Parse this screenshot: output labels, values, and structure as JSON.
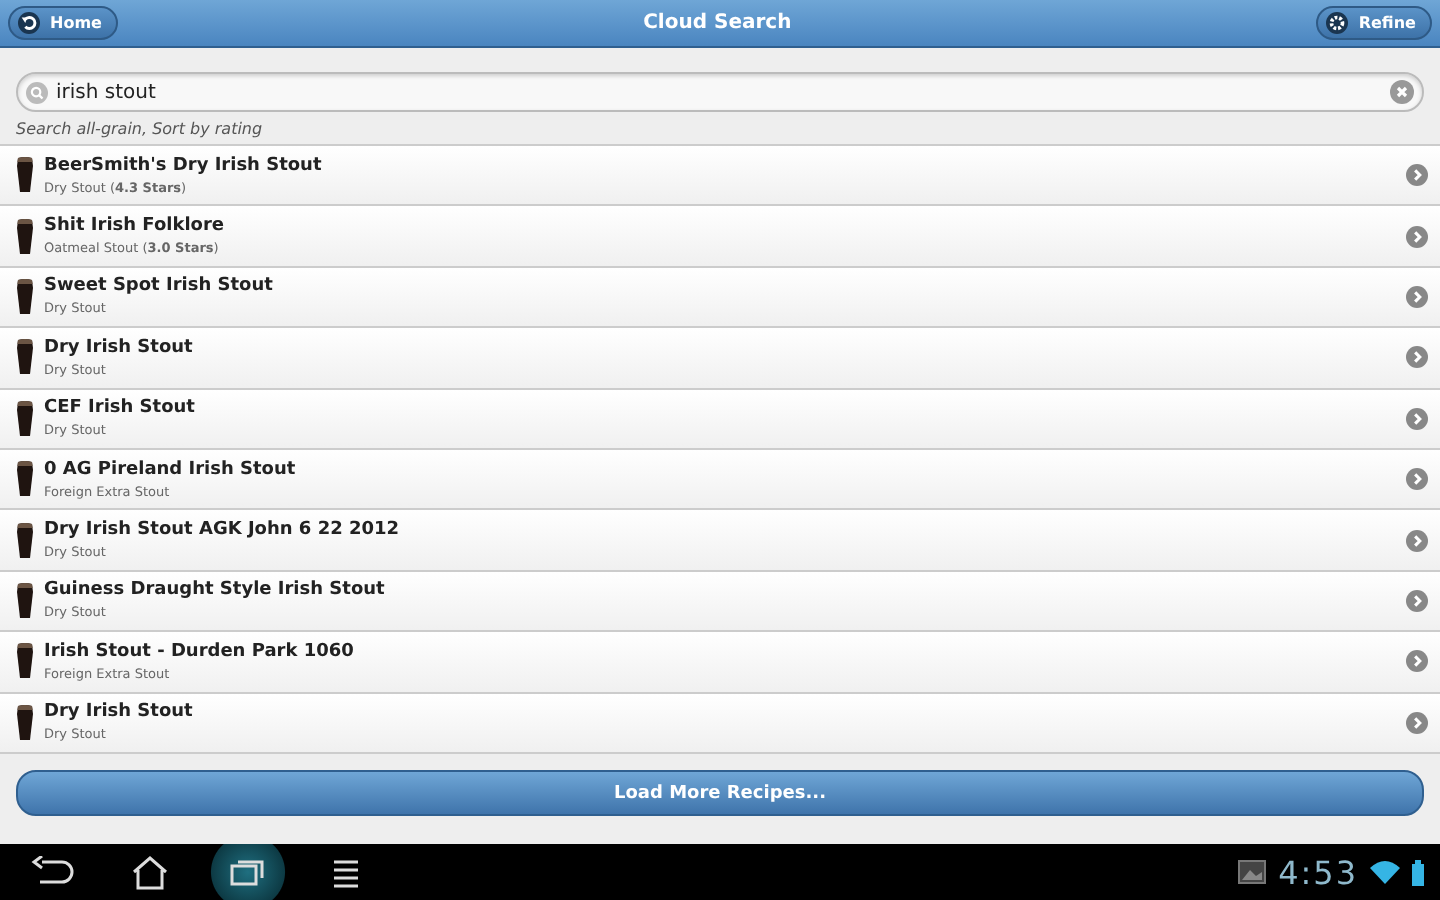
{
  "header": {
    "back_button": "Home",
    "title": "Cloud Search",
    "refine_button": "Refine"
  },
  "search": {
    "value": "irish stout"
  },
  "search_info": "Search all-grain, Sort by rating",
  "recipes": [
    {
      "name": "BeerSmith's Dry Irish Stout",
      "style": "Dry Stout (**4.3 Stars**)"
    },
    {
      "name": "Shit Irish Folklore",
      "style": "Oatmeal Stout (**3.0 Stars**)"
    },
    {
      "name": "Sweet Spot Irish Stout",
      "style": "Dry Stout"
    },
    {
      "name": "Dry Irish Stout",
      "style": "Dry Stout"
    },
    {
      "name": "CEF Irish Stout",
      "style": "Dry Stout"
    },
    {
      "name": "0 AG Pireland Irish Stout",
      "style": "Foreign Extra Stout"
    },
    {
      "name": "Dry Irish Stout AGK John 6 22 2012",
      "style": "Dry Stout"
    },
    {
      "name": "Guiness Draught Style Irish Stout",
      "style": "Dry Stout"
    },
    {
      "name": "Irish Stout - Durden Park 1060",
      "style": "Foreign Extra Stout"
    },
    {
      "name": "Dry Irish Stout",
      "style": "Dry Stout"
    }
  ],
  "load_more_button": "Load More Recipes...",
  "nav_buttons": [
    {
      "kind": "back",
      "selected": false
    },
    {
      "kind": "home",
      "selected": false
    },
    {
      "kind": "recent",
      "selected": true
    },
    {
      "kind": "menu",
      "selected": false
    }
  ],
  "status_bar": {
    "time": "4:53"
  }
}
